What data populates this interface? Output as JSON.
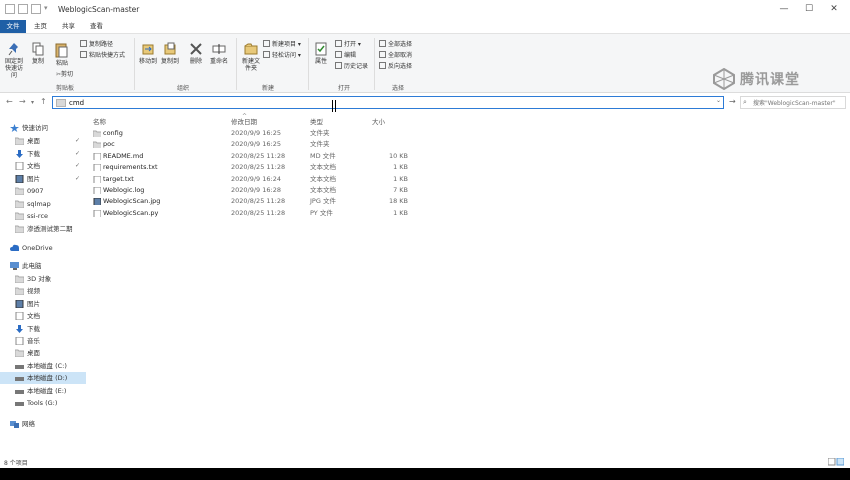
{
  "window": {
    "title": "WeblogicScan-master",
    "controls": [
      "—",
      "☐",
      "✕"
    ]
  },
  "ribbon_tabs": [
    "文件",
    "主页",
    "共享",
    "查看"
  ],
  "ribbon": {
    "clipboard": {
      "pin_label": "固定到快速访问",
      "copy_label": "复制",
      "paste_label": "粘贴",
      "copy_path_label": "复制路径",
      "paste_shortcut_label": "粘贴快捷方式",
      "cut_label": "剪切",
      "group_label": "剪贴板"
    },
    "organize": {
      "move_label": "移动到",
      "copyto_label": "复制到",
      "delete_label": "删除",
      "rename_label": "重命名",
      "group_label": "组织"
    },
    "new": {
      "newfolder_label": "新建文件夹",
      "newitem_label": "新建项目",
      "easyaccess_label": "轻松访问",
      "group_label": "新建"
    },
    "open": {
      "properties_label": "属性",
      "open_label": "打开",
      "edit_label": "编辑",
      "history_label": "历史记录",
      "group_label": "打开"
    },
    "select": {
      "selectall_label": "全部选择",
      "selectnone_label": "全部取消",
      "invert_label": "反向选择",
      "group_label": "选择"
    }
  },
  "address": {
    "value": "cmd"
  },
  "search": {
    "placeholder": "搜索\"WeblogicScan-master\""
  },
  "nav": {
    "quick_access": "快速访问",
    "quick_items": [
      {
        "label": "桌面",
        "pinned": true
      },
      {
        "label": "下载",
        "pinned": true
      },
      {
        "label": "文档",
        "pinned": true
      },
      {
        "label": "图片",
        "pinned": true
      },
      {
        "label": "0907",
        "pinned": false
      },
      {
        "label": "sqlmap",
        "pinned": false
      },
      {
        "label": "ssi-rce",
        "pinned": false
      },
      {
        "label": "渗透测试第二期",
        "pinned": false
      }
    ],
    "onedrive": "OneDrive",
    "this_pc": "此电脑",
    "pc_items": [
      "3D 对象",
      "视频",
      "图片",
      "文档",
      "下载",
      "音乐",
      "桌面",
      "本地磁盘 (C:)",
      "本地磁盘 (D:)",
      "本地磁盘 (E:)",
      "Tools (G:)"
    ],
    "network": "网络",
    "pin_glyph": "✓"
  },
  "columns": {
    "name": "名称",
    "date": "修改日期",
    "type": "类型",
    "size": "大小"
  },
  "files": [
    {
      "name": "config",
      "date": "2020/9/9 16:25",
      "type": "文件夹",
      "size": "",
      "kind": "folder"
    },
    {
      "name": "poc",
      "date": "2020/9/9 16:25",
      "type": "文件夹",
      "size": "",
      "kind": "folder"
    },
    {
      "name": "README.md",
      "date": "2020/8/25 11:28",
      "type": "MD 文件",
      "size": "10 KB",
      "kind": "doc"
    },
    {
      "name": "requirements.txt",
      "date": "2020/8/25 11:28",
      "type": "文本文档",
      "size": "1 KB",
      "kind": "doc"
    },
    {
      "name": "target.txt",
      "date": "2020/9/9 16:24",
      "type": "文本文档",
      "size": "1 KB",
      "kind": "doc"
    },
    {
      "name": "Weblogic.log",
      "date": "2020/9/9 16:28",
      "type": "文本文档",
      "size": "7 KB",
      "kind": "doc"
    },
    {
      "name": "WeblogicScan.jpg",
      "date": "2020/8/25 11:28",
      "type": "JPG 文件",
      "size": "18 KB",
      "kind": "img"
    },
    {
      "name": "WeblogicScan.py",
      "date": "2020/8/25 11:28",
      "type": "PY 文件",
      "size": "1 KB",
      "kind": "doc"
    }
  ],
  "status": {
    "count": "8 个项目"
  },
  "watermark": {
    "text": "腾讯课堂"
  },
  "colors": {
    "accent": "#1f5fa6",
    "selection": "#cce4f7",
    "folder": "#d9d9d9"
  }
}
